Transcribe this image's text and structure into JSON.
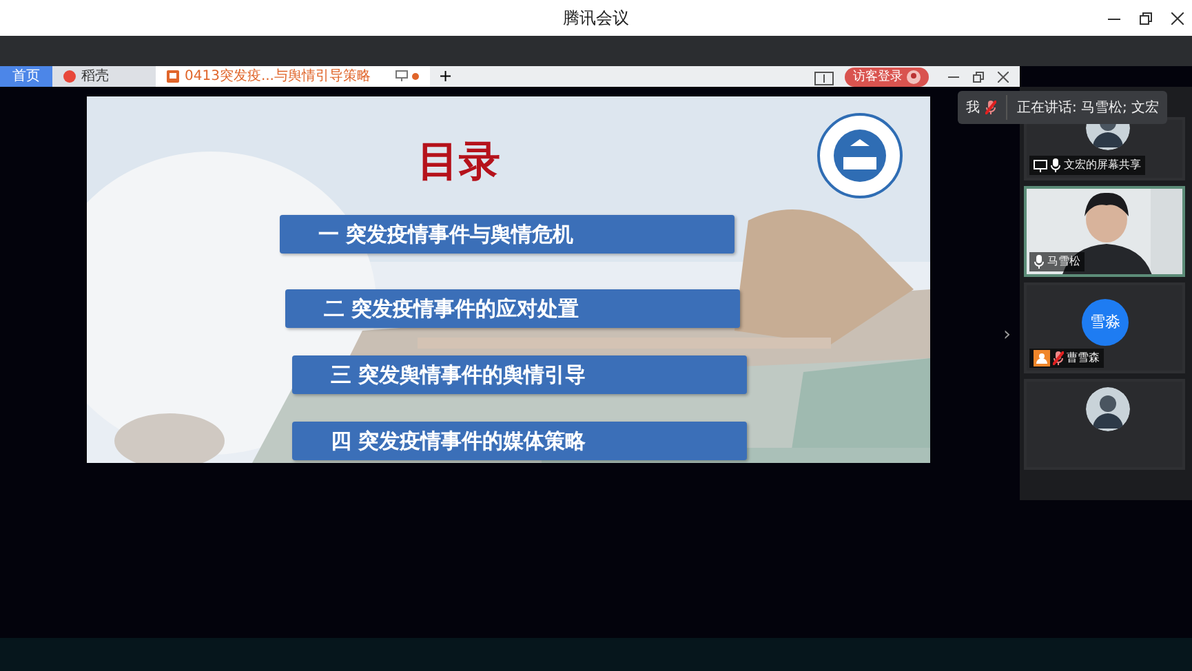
{
  "window": {
    "title": "腾讯会议"
  },
  "browser": {
    "tabs": [
      {
        "kind": "home",
        "label": "首页",
        "selected": false
      },
      {
        "kind": "docer",
        "label": "稻壳",
        "selected": false
      },
      {
        "kind": "document",
        "label": "0413突发疫...与舆情引导策略",
        "selected": true
      }
    ],
    "new_tab": "+",
    "login": "访客登录"
  },
  "slide": {
    "title": "目录",
    "items": [
      "一 突发疫情事件与舆情危机",
      "二  突发疫情事件的应对处置",
      "三  突发舆情事件的舆情引导",
      "四 突发疫情事件的媒体策略"
    ]
  },
  "expand": "›",
  "speaking": {
    "me": "我",
    "me_muted": true,
    "text": "正在讲话: 马雪松; 文宏"
  },
  "participants": [
    {
      "kind": "avatar",
      "name": "文宏的屏幕共享",
      "sharing": true,
      "muted": false,
      "speaking": false
    },
    {
      "kind": "video",
      "name": "马雪松",
      "sharing": false,
      "muted": false,
      "speaking": true
    },
    {
      "kind": "initials",
      "initials": "雪淼",
      "color": "#1e7cf2",
      "name": "曹雪森",
      "sharing": false,
      "muted": true,
      "speaking": false
    },
    {
      "kind": "avatar",
      "speaking": false
    }
  ]
}
